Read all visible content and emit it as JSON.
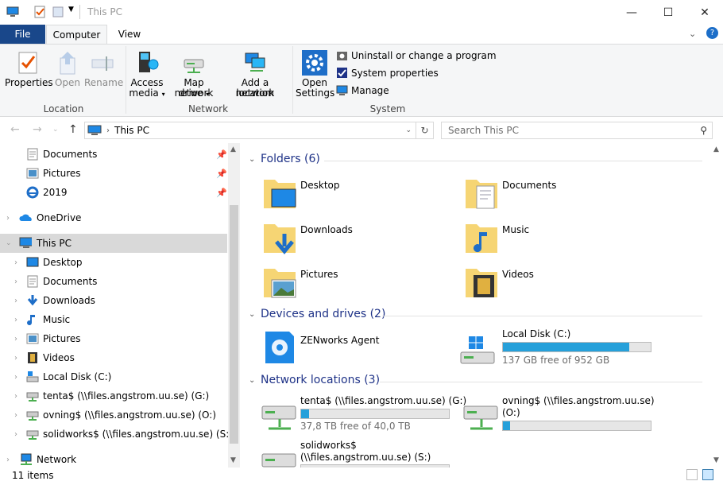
{
  "window": {
    "title": "This PC",
    "minimize": "—",
    "maximize": "☐",
    "close": "✕"
  },
  "ribbon": {
    "tabs": {
      "file": "File",
      "computer": "Computer",
      "view": "View"
    },
    "location": {
      "properties": "Properties",
      "open": "Open",
      "rename": "Rename",
      "group": "Location"
    },
    "network": {
      "access_media_1": "Access",
      "access_media_2": "media",
      "map_drive_1": "Map network",
      "map_drive_2": "drive",
      "add_loc_1": "Add a network",
      "add_loc_2": "location",
      "group": "Network"
    },
    "system": {
      "open_settings_1": "Open",
      "open_settings_2": "Settings",
      "uninstall": "Uninstall or change a program",
      "sys_props": "System properties",
      "manage": "Manage",
      "group": "System"
    }
  },
  "address": {
    "path": "This PC",
    "search_placeholder": "Search This PC"
  },
  "nav": {
    "quick": [
      {
        "label": "Documents",
        "icon": "documents-icon"
      },
      {
        "label": "Pictures",
        "icon": "pictures-icon"
      },
      {
        "label": "2019",
        "icon": "folder-ie-icon"
      }
    ],
    "onedrive": "OneDrive",
    "thispc": "This PC",
    "children": [
      "Desktop",
      "Documents",
      "Downloads",
      "Music",
      "Pictures",
      "Videos",
      "Local Disk (C:)",
      "tenta$ (\\\\files.angstrom.uu.se) (G:)",
      "ovning$ (\\\\files.angstrom.uu.se) (O:)",
      "solidworks$ (\\\\files.angstrom.uu.se) (S:)"
    ],
    "network": "Network"
  },
  "content": {
    "folders_header": "Folders (6)",
    "folders": [
      "Desktop",
      "Documents",
      "Downloads",
      "Music",
      "Pictures",
      "Videos"
    ],
    "devices_header": "Devices and drives (2)",
    "zenworks": "ZENworks Agent",
    "localdisk": {
      "label": "Local Disk (C:)",
      "free": "137 GB free of 952 GB",
      "used_fraction": 0.856
    },
    "network_header": "Network locations (3)",
    "tenta": {
      "label": "tenta$ (\\\\files.angstrom.uu.se) (G:)",
      "free": "37,8 TB free of 40,0 TB",
      "used_fraction": 0.055
    },
    "ovning": {
      "label1": "ovning$ (\\\\files.angstrom.uu.se)",
      "label2": "(O:)",
      "used_fraction": 0.05
    },
    "solidworks": {
      "label1": "solidworks$",
      "label2": "(\\\\files.angstrom.uu.se) (S:)"
    }
  },
  "status": {
    "items": "11 items"
  },
  "colors": {
    "accent": "#19478a",
    "bar": "#26a0da",
    "header": "#1e3287"
  }
}
